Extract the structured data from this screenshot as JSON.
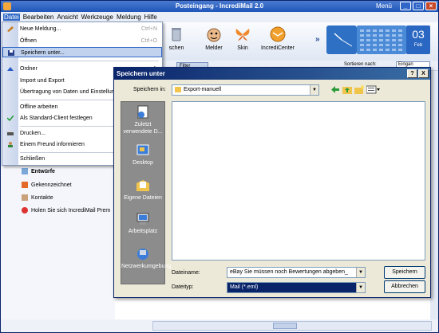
{
  "window": {
    "title": "Posteingang - IncrediMail 2.0",
    "menu_label": "Menü"
  },
  "menubar": [
    "Datei",
    "Bearbeiten",
    "Ansicht",
    "Werkzeuge",
    "Meldung",
    "Hilfe"
  ],
  "toolbar": {
    "items": [
      {
        "label": "schen",
        "icon": "delete-icon"
      },
      {
        "label": "Melder",
        "icon": "notifier-icon"
      },
      {
        "label": "Skin",
        "icon": "skin-icon"
      },
      {
        "label": "IncrediCenter",
        "icon": "incredicenter-icon"
      }
    ],
    "date_day": "03",
    "date_month": "Feb"
  },
  "subbar": {
    "filter_label": "Filter",
    "sort_label": "Sortieren nach:",
    "sort_value": "Eingan"
  },
  "file_menu": {
    "items": [
      {
        "label": "Neue Meldung...",
        "shortcut": "Ctrl+N",
        "icon": "new-message-icon"
      },
      {
        "label": "Öffnen",
        "shortcut": "Ctrl+O",
        "icon": ""
      },
      {
        "label": "Speichern unter...",
        "shortcut": "",
        "icon": "save-icon",
        "highlight": true
      },
      {
        "label": "Ordner",
        "shortcut": "",
        "icon": "folder-icon",
        "submenu": true
      },
      {
        "label": "Import und Export",
        "shortcut": "",
        "icon": "",
        "submenu": true
      },
      {
        "label": "Übertragung von Daten und Einstellun",
        "shortcut": "",
        "icon": ""
      },
      {
        "label": "Offline arbeiten",
        "shortcut": "",
        "icon": ""
      },
      {
        "label": "Als Standard-Client festlegen",
        "shortcut": "",
        "icon": "default-client-icon"
      },
      {
        "label": "Drucken...",
        "shortcut": "",
        "icon": "print-icon"
      },
      {
        "label": "Einem Freund informieren",
        "shortcut": "",
        "icon": "friend-icon"
      },
      {
        "label": "Schließen",
        "shortcut": "",
        "icon": ""
      }
    ]
  },
  "folders": [
    {
      "label": "Entwürfe",
      "icon": "drafts-icon"
    },
    {
      "label": "Gekennzeichnet",
      "icon": "flag-icon"
    },
    {
      "label": "Kontakte",
      "icon": "contacts-icon"
    },
    {
      "label": "Holen Sie sich IncrediMail Prem",
      "icon": "premium-icon"
    }
  ],
  "dialog": {
    "title": "Speichern unter",
    "help_btn": "?",
    "close_btn": "X",
    "save_in_label": "Speichern in:",
    "save_in_value": "Export-manuell",
    "places": [
      "Zuletzt verwendete D...",
      "Desktop",
      "Eigene Dateien",
      "Arbeitsplatz",
      "Netzwerkumgebung"
    ],
    "filename_label": "Dateiname:",
    "filename_value": "eBay Sie müssen noch Bewertungen abgeben_",
    "filetype_label": "Dateityp:",
    "filetype_value": "Mail (*.eml)",
    "save_button": "Speichern",
    "cancel_button": "Abbrechen"
  },
  "colors": {
    "titlebar": "#1e56b9",
    "dialog_title": "#0a246a",
    "places_bar": "#8c8c8c",
    "highlight": "#3169c6"
  }
}
